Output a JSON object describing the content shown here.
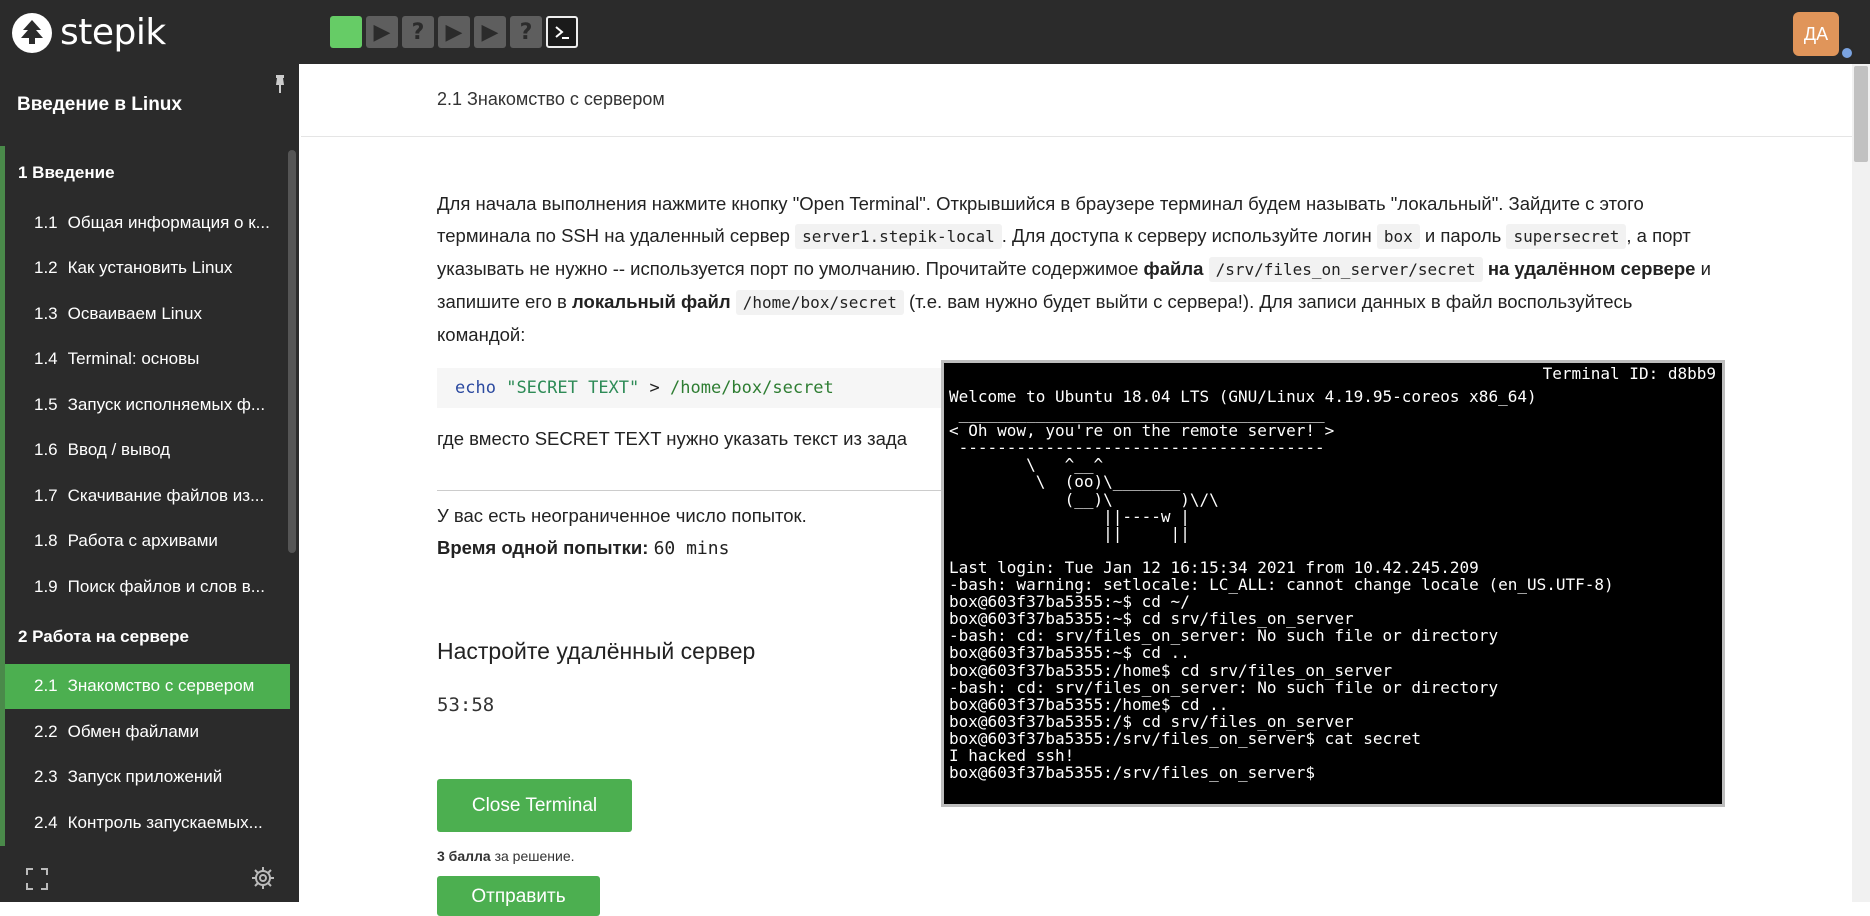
{
  "header": {
    "logo_text": "stepik",
    "steps": [
      {
        "icon": "check-block",
        "state": "done"
      },
      {
        "icon": "play-icon",
        "state": "todo"
      },
      {
        "icon": "question-icon",
        "state": "todo"
      },
      {
        "icon": "play-icon",
        "state": "todo"
      },
      {
        "icon": "play-icon",
        "state": "todo"
      },
      {
        "icon": "question-icon",
        "state": "todo"
      },
      {
        "icon": "terminal-icon",
        "state": "active"
      }
    ],
    "avatar_initials": "ДА"
  },
  "sidebar": {
    "course_title": "Введение в Linux",
    "sections": [
      {
        "title": "1  Введение",
        "lessons": [
          {
            "num": "1.1",
            "label": "Общая информация о к..."
          },
          {
            "num": "1.2",
            "label": "Как установить Linux"
          },
          {
            "num": "1.3",
            "label": "Осваиваем Linux"
          },
          {
            "num": "1.4",
            "label": "Terminal: основы"
          },
          {
            "num": "1.5",
            "label": "Запуск исполняемых ф..."
          },
          {
            "num": "1.6",
            "label": "Ввод / вывод"
          },
          {
            "num": "1.7",
            "label": "Скачивание файлов из..."
          },
          {
            "num": "1.8",
            "label": "Работа с архивами"
          },
          {
            "num": "1.9",
            "label": "Поиск файлов и слов в..."
          }
        ]
      },
      {
        "title": "2  Работа на сервере",
        "lessons": [
          {
            "num": "2.1",
            "label": "Знакомство с сервером"
          },
          {
            "num": "2.2",
            "label": "Обмен файлами"
          },
          {
            "num": "2.3",
            "label": "Запуск приложений"
          },
          {
            "num": "2.4",
            "label": "Контроль запускаемых..."
          }
        ]
      }
    ]
  },
  "main": {
    "page_title": "2.1 Знакомство с сервером",
    "p1": "Для начала выполнения нажмите кнопку \"Open Terminal\". Открывшийся в браузере терминал будем называть \"локальный\". Зайдите с этого терминала по SSH на удаленный сервер ",
    "server": "server1.stepik-local",
    "p2": ". Для доступа к серверу используйте логин ",
    "login": "box",
    "p3": " и пароль ",
    "password": "supersecret",
    "p4": ", а порт указывать не нужно -- используется порт по умолчанию. Прочитайте содержимое ",
    "file_word": "файла",
    "remote_path": "/srv/files_on_server/secret",
    "on_remote": "на удалённом сервере",
    "p5": " и запишите его в ",
    "local_file": "локальный файл",
    "local_path": "/home/box/secret",
    "p6": " (т.е. вам нужно будет выйти с сервера!). Для записи данных в файл воспользуйтесь командой:",
    "code_cmd": "echo",
    "code_str": "\"SECRET TEXT\"",
    "code_op": ">",
    "code_path": "/home/box/secret",
    "after_code": "где вместо SECRET TEXT нужно указать текст из зада",
    "attempts": "У вас есть неограниченное число попыток.",
    "time_label": "Время одной попытки:",
    "time_value": "60 mins",
    "section_heading": "Настройте удалённый сервер",
    "timer": "53:58",
    "close_button": "Close Terminal",
    "score_bold": "3 балла",
    "score_rest": " за решение.",
    "send_button": "Отправить"
  },
  "terminal": {
    "id_label": "Terminal ID: d8bb9",
    "lines": [
      "Welcome to Ubuntu 18.04 LTS (GNU/Linux 4.19.95-coreos x86_64)",
      " ______________________________________",
      "< Oh wow, you're on the remote server! >",
      " --------------------------------------",
      "        \\   ^__^",
      "         \\  (oo)\\_______",
      "            (__)\\       )\\/\\",
      "                ||----w |",
      "                ||     ||",
      "",
      "Last login: Tue Jan 12 16:15:34 2021 from 10.42.245.209",
      "-bash: warning: setlocale: LC_ALL: cannot change locale (en_US.UTF-8)",
      "box@603f37ba5355:~$ cd ~/",
      "box@603f37ba5355:~$ cd srv/files_on_server",
      "-bash: cd: srv/files_on_server: No such file or directory",
      "box@603f37ba5355:~$ cd ..",
      "box@603f37ba5355:/home$ cd srv/files_on_server",
      "-bash: cd: srv/files_on_server: No such file or directory",
      "box@603f37ba5355:/home$ cd ..",
      "box@603f37ba5355:/$ cd srv/files_on_server",
      "box@603f37ba5355:/srv/files_on_server$ cat secret",
      "I hacked ssh!",
      "box@603f37ba5355:/srv/files_on_server$"
    ]
  },
  "colors": {
    "accent": "#4caf50",
    "topbar": "#2b2b2b",
    "avatar": "#e0955a"
  }
}
